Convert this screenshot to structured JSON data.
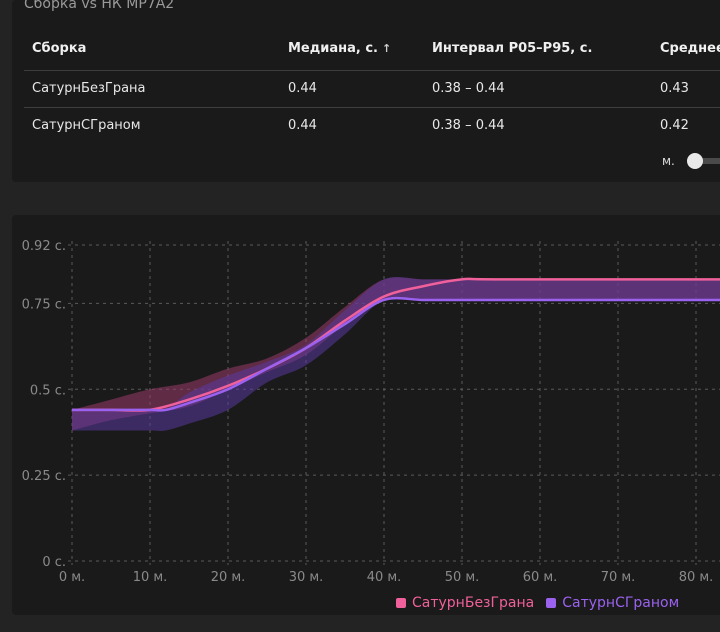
{
  "panel_title": "Сборка vs НК МР7А2",
  "table": {
    "headers": {
      "build": "Сборка",
      "median": "Медиана, с.",
      "median_sort_icon": "sort-asc-arrow",
      "interval": "Интервал P05–P95, с.",
      "mean": "Среднее"
    },
    "rows": [
      {
        "build": "СатурнБезГрана",
        "median": "0.44",
        "interval": "0.38 – 0.44",
        "mean": "0.43"
      },
      {
        "build": "СатурнСГраном",
        "median": "0.44",
        "interval": "0.38 – 0.44",
        "mean": "0.42"
      }
    ]
  },
  "toggle": {
    "label": "м.",
    "on": false
  },
  "chart_data": {
    "type": "area",
    "xlim": [
      0,
      84
    ],
    "ylim": [
      0,
      0.92
    ],
    "grid": true,
    "legend_position": "bottom-right",
    "x_ticks": [
      0,
      10,
      20,
      30,
      40,
      50,
      60,
      70,
      80
    ],
    "x_tick_labels": [
      "0 м.",
      "10 м.",
      "20 м.",
      "30 м.",
      "40 м.",
      "50 м.",
      "60 м.",
      "70 м.",
      "80 м."
    ],
    "y_ticks": [
      0,
      0.25,
      0.5,
      0.75,
      0.92
    ],
    "y_tick_labels": [
      "0 с.",
      "0.25 с.",
      "0.5 с.",
      "0.75 с.",
      "0.92 с."
    ],
    "series": [
      {
        "name": "СатурнБезГрана",
        "color": "#f0609a",
        "band_color": "#9a3a6a",
        "median": [
          [
            0,
            0.44
          ],
          [
            5,
            0.44
          ],
          [
            10,
            0.44
          ],
          [
            15,
            0.47
          ],
          [
            20,
            0.51
          ],
          [
            25,
            0.56
          ],
          [
            30,
            0.62
          ],
          [
            35,
            0.7
          ],
          [
            40,
            0.77
          ],
          [
            45,
            0.8
          ],
          [
            50,
            0.82
          ],
          [
            55,
            0.82
          ],
          [
            84,
            0.82
          ]
        ],
        "lower": [
          [
            0,
            0.38
          ],
          [
            5,
            0.41
          ],
          [
            10,
            0.43
          ],
          [
            15,
            0.45
          ],
          [
            20,
            0.5
          ],
          [
            25,
            0.55
          ],
          [
            30,
            0.6
          ],
          [
            35,
            0.69
          ],
          [
            40,
            0.76
          ],
          [
            45,
            0.76
          ],
          [
            50,
            0.76
          ],
          [
            55,
            0.76
          ],
          [
            84,
            0.76
          ]
        ],
        "upper": [
          [
            0,
            0.44
          ],
          [
            5,
            0.47
          ],
          [
            10,
            0.5
          ],
          [
            15,
            0.52
          ],
          [
            20,
            0.56
          ],
          [
            25,
            0.59
          ],
          [
            30,
            0.65
          ],
          [
            35,
            0.74
          ],
          [
            40,
            0.82
          ],
          [
            45,
            0.82
          ],
          [
            50,
            0.82
          ],
          [
            55,
            0.82
          ],
          [
            84,
            0.82
          ]
        ]
      },
      {
        "name": "СатурнСГраном",
        "color": "#9b62f0",
        "band_color": "#5a3aa0",
        "median": [
          [
            0,
            0.44
          ],
          [
            5,
            0.44
          ],
          [
            10,
            0.44
          ],
          [
            12,
            0.44
          ],
          [
            15,
            0.46
          ],
          [
            20,
            0.5
          ],
          [
            25,
            0.56
          ],
          [
            30,
            0.62
          ],
          [
            35,
            0.69
          ],
          [
            40,
            0.76
          ],
          [
            45,
            0.76
          ],
          [
            50,
            0.76
          ],
          [
            84,
            0.76
          ]
        ],
        "lower": [
          [
            0,
            0.38
          ],
          [
            5,
            0.38
          ],
          [
            10,
            0.38
          ],
          [
            12,
            0.38
          ],
          [
            15,
            0.4
          ],
          [
            20,
            0.44
          ],
          [
            25,
            0.52
          ],
          [
            30,
            0.57
          ],
          [
            35,
            0.66
          ],
          [
            40,
            0.76
          ],
          [
            45,
            0.76
          ],
          [
            50,
            0.76
          ],
          [
            84,
            0.76
          ]
        ],
        "upper": [
          [
            0,
            0.44
          ],
          [
            5,
            0.44
          ],
          [
            10,
            0.44
          ],
          [
            12,
            0.44
          ],
          [
            15,
            0.49
          ],
          [
            20,
            0.54
          ],
          [
            25,
            0.58
          ],
          [
            30,
            0.63
          ],
          [
            35,
            0.73
          ],
          [
            40,
            0.82
          ],
          [
            45,
            0.82
          ],
          [
            50,
            0.82
          ],
          [
            84,
            0.82
          ]
        ]
      }
    ]
  }
}
